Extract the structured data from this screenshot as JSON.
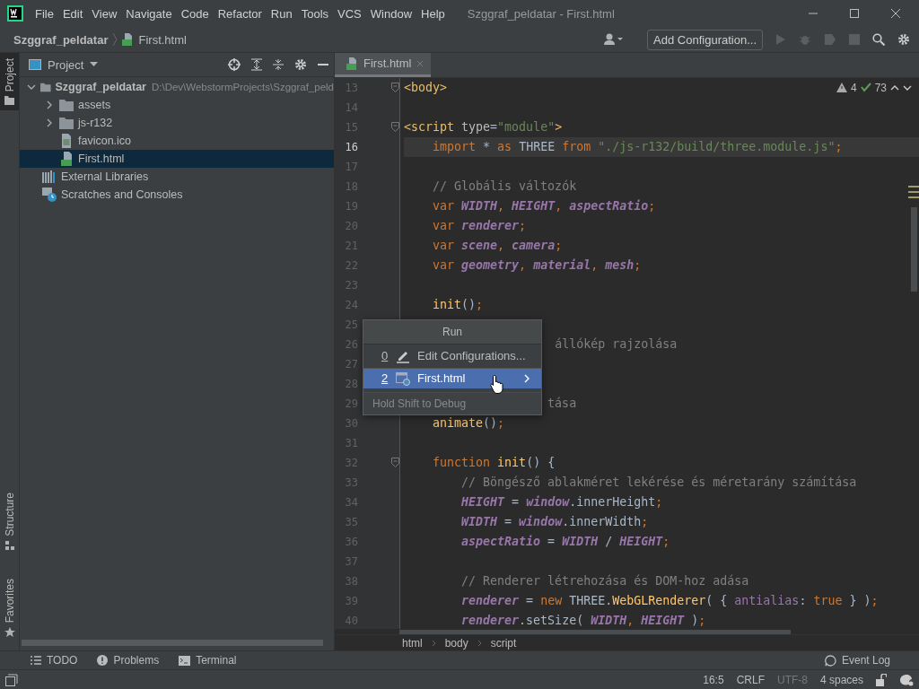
{
  "window": {
    "title": "Szggraf_peldatar - First.html"
  },
  "menu": [
    "File",
    "Edit",
    "View",
    "Navigate",
    "Code",
    "Refactor",
    "Run",
    "Tools",
    "VCS",
    "Window",
    "Help"
  ],
  "navbar": {
    "crumbs": [
      {
        "label": "Szggraf_peldatar",
        "kind": "project"
      },
      {
        "label": "First.html",
        "kind": "html"
      }
    ],
    "run_config": "Add Configuration..."
  },
  "left_stripe": [
    {
      "label": "Project",
      "kind": "project",
      "selected": true
    },
    {
      "label": "Structure",
      "kind": "structure",
      "selected": false
    },
    {
      "label": "Favorites",
      "kind": "favorites",
      "selected": false
    }
  ],
  "project_panel": {
    "title": "Project",
    "tree": [
      {
        "label": "Szggraf_peldatar",
        "path": "D:\\Dev\\WebstormProjects\\Szggraf_peld",
        "kind": "folder",
        "expanded": true,
        "selected": false,
        "children": [
          {
            "label": "assets",
            "kind": "folder",
            "expanded": false,
            "selected": false
          },
          {
            "label": "js-r132",
            "kind": "folder",
            "expanded": false,
            "selected": false
          },
          {
            "label": "favicon.ico",
            "kind": "image",
            "selected": false
          },
          {
            "label": "First.html",
            "kind": "html",
            "selected": true
          }
        ]
      },
      {
        "label": "External Libraries",
        "kind": "libraries",
        "selected": false
      },
      {
        "label": "Scratches and Consoles",
        "kind": "scratches",
        "selected": false
      }
    ]
  },
  "editor": {
    "tabs": [
      {
        "label": "First.html",
        "selected": true
      }
    ],
    "warnings": "4",
    "checks": "73",
    "lines": [
      {
        "number": "13",
        "current": false,
        "fold": true,
        "tokens": [
          {
            "text": "<body>",
            "kind": "tag"
          }
        ]
      },
      {
        "number": "14",
        "current": false,
        "fold": false
      },
      {
        "number": "15",
        "current": false,
        "fold": true,
        "tokens": [
          {
            "text": "<script ",
            "kind": "tag"
          },
          {
            "text": "type",
            "kind": "attr"
          },
          {
            "text": "=",
            "kind": "plain"
          },
          {
            "text": "\"module\"",
            "kind": "str"
          },
          {
            "text": ">",
            "kind": "tag"
          }
        ]
      },
      {
        "number": "16",
        "current": true,
        "fold": false,
        "tokens": [
          {
            "text": "    import",
            "kind": "kw"
          },
          {
            "text": " * ",
            "kind": "plain"
          },
          {
            "text": "as",
            "kind": "kw"
          },
          {
            "text": " THREE ",
            "kind": "plain"
          },
          {
            "text": "from",
            "kind": "kw"
          },
          {
            "text": " \"./js-r132/build/three.module.js\"",
            "kind": "str"
          },
          {
            "text": ";",
            "kind": "kw"
          }
        ]
      },
      {
        "number": "17",
        "current": false,
        "fold": false
      },
      {
        "number": "18",
        "current": false,
        "fold": false,
        "tokens": [
          {
            "text": "    // Globális változók",
            "kind": "com"
          }
        ]
      },
      {
        "number": "19",
        "current": false,
        "fold": false,
        "tokens": [
          {
            "text": "    var ",
            "kind": "kw"
          },
          {
            "text": "WIDTH",
            "kind": "var"
          },
          {
            "text": ", ",
            "kind": "kw"
          },
          {
            "text": "HEIGHT",
            "kind": "var"
          },
          {
            "text": ", ",
            "kind": "kw"
          },
          {
            "text": "aspectRatio",
            "kind": "var"
          },
          {
            "text": ";",
            "kind": "kw"
          }
        ]
      },
      {
        "number": "20",
        "current": false,
        "fold": false,
        "tokens": [
          {
            "text": "    var ",
            "kind": "kw"
          },
          {
            "text": "renderer",
            "kind": "var"
          },
          {
            "text": ";",
            "kind": "kw"
          }
        ]
      },
      {
        "number": "21",
        "current": false,
        "fold": false,
        "tokens": [
          {
            "text": "    var ",
            "kind": "kw"
          },
          {
            "text": "scene",
            "kind": "var"
          },
          {
            "text": ", ",
            "kind": "kw"
          },
          {
            "text": "camera",
            "kind": "var"
          },
          {
            "text": ";",
            "kind": "kw"
          }
        ]
      },
      {
        "number": "22",
        "current": false,
        "fold": false,
        "tokens": [
          {
            "text": "    var ",
            "kind": "kw"
          },
          {
            "text": "geometry",
            "kind": "var"
          },
          {
            "text": ", ",
            "kind": "kw"
          },
          {
            "text": "material",
            "kind": "var"
          },
          {
            "text": ", ",
            "kind": "kw"
          },
          {
            "text": "mesh",
            "kind": "var"
          },
          {
            "text": ";",
            "kind": "kw"
          }
        ]
      },
      {
        "number": "23",
        "current": false,
        "fold": false
      },
      {
        "number": "24",
        "current": false,
        "fold": false,
        "tokens": [
          {
            "text": "    init",
            "kind": "fn"
          },
          {
            "text": "()",
            "kind": "plain"
          },
          {
            "text": ";",
            "kind": "kw"
          }
        ]
      },
      {
        "number": "25",
        "current": false,
        "fold": false
      },
      {
        "number": "26",
        "current": false,
        "fold": false,
        "tokens": [
          {
            "text": "                     állókép rajzolása",
            "kind": "com"
          }
        ]
      },
      {
        "number": "27",
        "current": false,
        "fold": false
      },
      {
        "number": "28",
        "current": false,
        "fold": false
      },
      {
        "number": "29",
        "current": false,
        "fold": false,
        "tokens": [
          {
            "text": "                    tása",
            "kind": "com"
          }
        ]
      },
      {
        "number": "30",
        "current": false,
        "fold": false,
        "tokens": [
          {
            "text": "    animate",
            "kind": "fn"
          },
          {
            "text": "()",
            "kind": "plain"
          },
          {
            "text": ";",
            "kind": "kw"
          }
        ]
      },
      {
        "number": "31",
        "current": false,
        "fold": false
      },
      {
        "number": "32",
        "current": false,
        "fold": true,
        "tokens": [
          {
            "text": "    function ",
            "kind": "kw"
          },
          {
            "text": "init",
            "kind": "fn"
          },
          {
            "text": "() {",
            "kind": "plain"
          }
        ]
      },
      {
        "number": "33",
        "current": false,
        "fold": false,
        "tokens": [
          {
            "text": "        // Böngésző ablakméret lekérése és méretarány számítása",
            "kind": "com"
          }
        ]
      },
      {
        "number": "34",
        "current": false,
        "fold": false,
        "tokens": [
          {
            "text": "        HEIGHT",
            "kind": "var"
          },
          {
            "text": " = ",
            "kind": "plain"
          },
          {
            "text": "window",
            "kind": "var"
          },
          {
            "text": ".innerHeight",
            "kind": "plain"
          },
          {
            "text": ";",
            "kind": "kw"
          }
        ]
      },
      {
        "number": "35",
        "current": false,
        "fold": false,
        "tokens": [
          {
            "text": "        WIDTH",
            "kind": "var"
          },
          {
            "text": " = ",
            "kind": "plain"
          },
          {
            "text": "window",
            "kind": "var"
          },
          {
            "text": ".innerWidth",
            "kind": "plain"
          },
          {
            "text": ";",
            "kind": "kw"
          }
        ]
      },
      {
        "number": "36",
        "current": false,
        "fold": false,
        "tokens": [
          {
            "text": "        aspectRatio",
            "kind": "var"
          },
          {
            "text": " = ",
            "kind": "plain"
          },
          {
            "text": "WIDTH",
            "kind": "var"
          },
          {
            "text": " / ",
            "kind": "plain"
          },
          {
            "text": "HEIGHT",
            "kind": "var"
          },
          {
            "text": ";",
            "kind": "kw"
          }
        ]
      },
      {
        "number": "37",
        "current": false,
        "fold": false
      },
      {
        "number": "38",
        "current": false,
        "fold": false,
        "tokens": [
          {
            "text": "        // Renderer létrehozása és DOM-hoz adása",
            "kind": "com"
          }
        ]
      },
      {
        "number": "39",
        "current": false,
        "fold": false,
        "tokens": [
          {
            "text": "        renderer",
            "kind": "var"
          },
          {
            "text": " = ",
            "kind": "plain"
          },
          {
            "text": "new",
            "kind": "kw"
          },
          {
            "text": " THREE.",
            "kind": "plain"
          },
          {
            "text": "WebGLRenderer",
            "kind": "fn"
          },
          {
            "text": "( { ",
            "kind": "plain"
          },
          {
            "text": "antialias",
            "kind": "prop"
          },
          {
            "text": ": ",
            "kind": "plain"
          },
          {
            "text": "true",
            "kind": "kw"
          },
          {
            "text": " } )",
            "kind": "plain"
          },
          {
            "text": ";",
            "kind": "kw"
          }
        ]
      },
      {
        "number": "40",
        "current": false,
        "fold": false,
        "tokens": [
          {
            "text": "        renderer",
            "kind": "var"
          },
          {
            "text": ".setSize( ",
            "kind": "plain"
          },
          {
            "text": "WIDTH",
            "kind": "var"
          },
          {
            "text": ", ",
            "kind": "kw"
          },
          {
            "text": "HEIGHT",
            "kind": "var"
          },
          {
            "text": " )",
            "kind": "plain"
          },
          {
            "text": ";",
            "kind": "kw"
          }
        ]
      }
    ],
    "breadcrumbs": [
      "html",
      "body",
      "script"
    ]
  },
  "popup": {
    "title": "Run",
    "items": [
      {
        "mnemonic": "0",
        "label": "Edit Configurations...",
        "kind": "edit",
        "selected": false
      },
      {
        "mnemonic": "2",
        "label": "First.html",
        "kind": "config",
        "selected": true
      }
    ],
    "hint": "Hold Shift to Debug"
  },
  "tool_windows": [
    {
      "label": "TODO",
      "kind": "todo"
    },
    {
      "label": "Problems",
      "kind": "problems"
    },
    {
      "label": "Terminal",
      "kind": "terminal"
    }
  ],
  "event_log": "Event Log",
  "status_bar": [
    {
      "text": "16:5",
      "kind": "normal"
    },
    {
      "text": "CRLF",
      "kind": "normal"
    },
    {
      "text": "UTF-8",
      "kind": "dim"
    },
    {
      "text": "4 spaces",
      "kind": "normal"
    }
  ]
}
